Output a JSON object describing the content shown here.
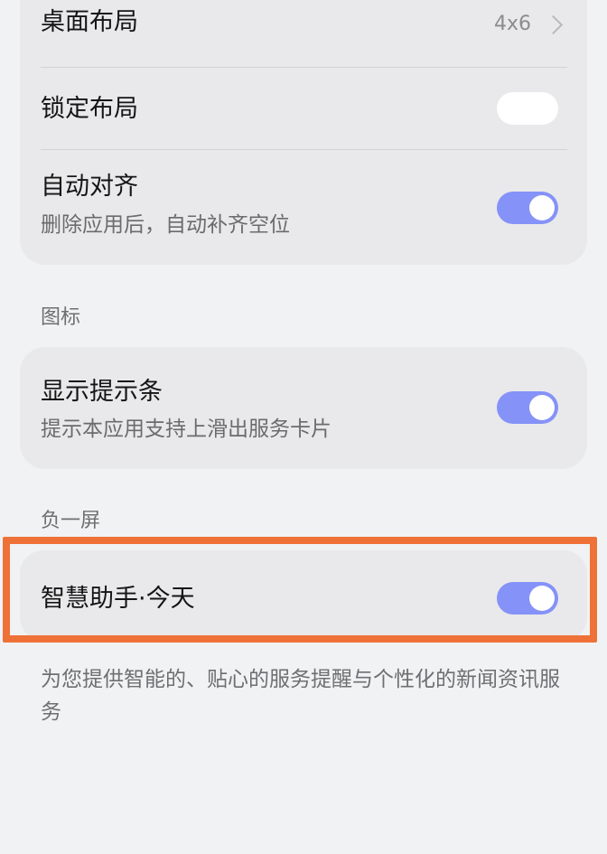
{
  "layout_section": {
    "items": [
      {
        "title": "桌面布局",
        "value": "4x6"
      },
      {
        "title": "锁定布局",
        "toggle": "off"
      },
      {
        "title": "自动对齐",
        "subtitle": "删除应用后，自动补齐空位",
        "toggle": "on"
      }
    ]
  },
  "icon_section": {
    "header": "图标",
    "items": [
      {
        "title": "显示提示条",
        "subtitle": "提示本应用支持上滑出服务卡片",
        "toggle": "on"
      }
    ]
  },
  "minus_one_section": {
    "header": "负一屏",
    "items": [
      {
        "title": "智慧助手·今天",
        "toggle": "on"
      }
    ],
    "footer": "为您提供智能的、贴心的服务提醒与个性化的新闻资讯服务"
  },
  "colors": {
    "accent_toggle": "#8592f7",
    "highlight_border": "#ee7138",
    "card_background": "#e9e9eb",
    "page_background": "#f1f2f4"
  }
}
